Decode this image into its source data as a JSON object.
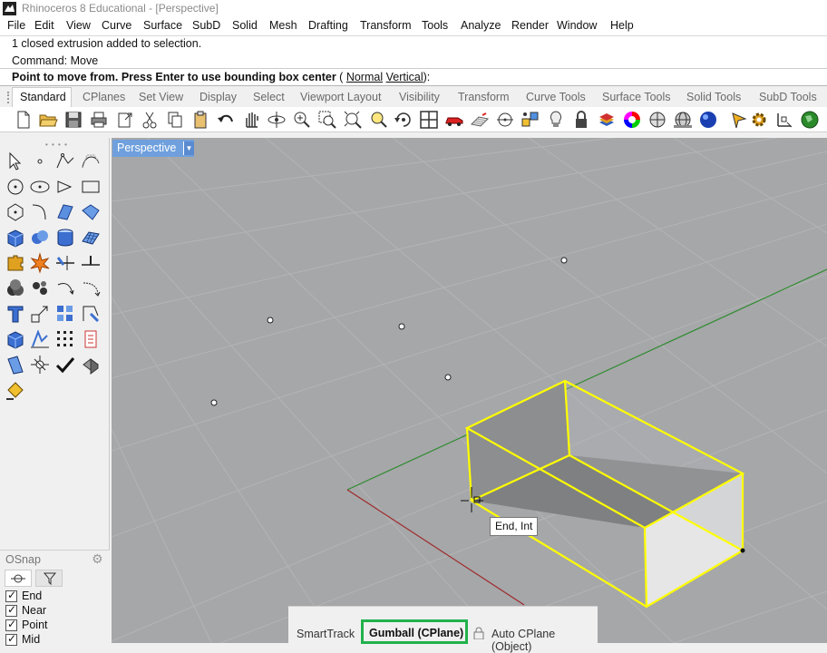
{
  "window": {
    "title": "Rhinoceros 8 Educational - [Perspective]"
  },
  "menu": [
    "File",
    "Edit",
    "View",
    "Curve",
    "Surface",
    "SubD",
    "Solid",
    "Mesh",
    "Drafting",
    "Transform",
    "Tools",
    "Analyze",
    "Render",
    "Window",
    "Help"
  ],
  "command": {
    "history_1": "1 closed extrusion added to selection.",
    "history_2": "Command: Move",
    "prompt": "Point to move from. Press Enter to use bounding box center",
    "options_open": "(",
    "option_1": "Normal",
    "option_2": "Vertical",
    "options_close": "):"
  },
  "toolbar_tabs": [
    "Standard",
    "CPlanes",
    "Set View",
    "Display",
    "Select",
    "Viewport Layout",
    "Visibility",
    "Transform",
    "Curve Tools",
    "Surface Tools",
    "Solid Tools",
    "SubD Tools"
  ],
  "toolbar_icons": [
    "new-file-icon",
    "open-file-icon",
    "save-icon",
    "print-icon",
    "import-icon",
    "cut-icon",
    "copy-icon",
    "paste-icon",
    "undo-icon",
    "pan-icon",
    "rotate-view-icon",
    "zoom-dynamic-icon",
    "zoom-window-icon",
    "zoom-extents-icon",
    "zoom-selected-icon",
    "rotate-icon",
    "four-viewports-icon",
    "car-icon",
    "cplane-icon",
    "circle-icon",
    "points-icon",
    "bulb-icon",
    "lock-icon",
    "layers-icon",
    "color-wheel-icon",
    "shaded-sphere-icon",
    "mesh-sphere-icon",
    "render-sphere-icon",
    "pen-icon",
    "gear-icon",
    "gumball-icon",
    "globe-icon"
  ],
  "viewport": {
    "name": "Perspective",
    "tooltip": "End, Int"
  },
  "osnap": {
    "title": "OSnap",
    "items": [
      {
        "label": "End",
        "checked": true
      },
      {
        "label": "Near",
        "checked": true
      },
      {
        "label": "Point",
        "checked": true
      },
      {
        "label": "Mid",
        "checked": true
      }
    ]
  },
  "status": {
    "smarttrack": "SmartTrack",
    "gumball": "Gumball (CPlane)",
    "auto_cplane": "Auto CPlane (Object)"
  },
  "colors": {
    "viewport_bg": "#a6a7a9",
    "selection": "#ffff00",
    "x_axis": "#9e2a2a",
    "y_axis": "#2e8b2e",
    "highlight_box": "#22b14c",
    "viewport_title": "#6fa0dd"
  }
}
